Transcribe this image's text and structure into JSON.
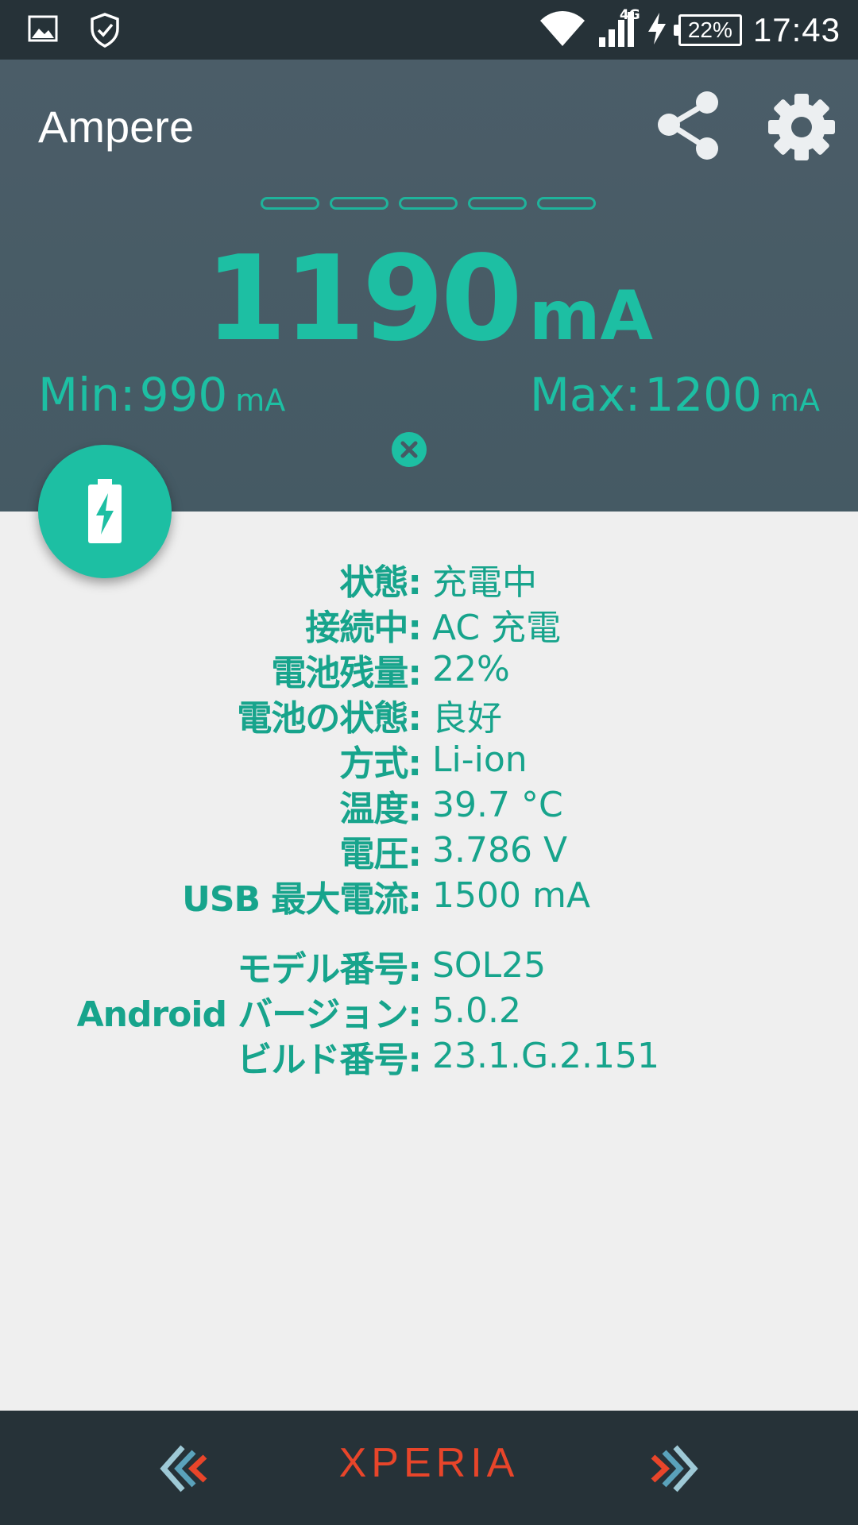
{
  "status_bar": {
    "time": "17:43",
    "battery_percent": "22%",
    "network_type": "4G",
    "icons": [
      "image-icon",
      "shield-check-icon",
      "wifi-icon",
      "cell-signal-icon",
      "charging-bolt-icon",
      "battery-icon"
    ]
  },
  "app": {
    "title": "Ampere",
    "actions": [
      "share-icon",
      "gear-icon"
    ]
  },
  "meter": {
    "current_value": "1190",
    "current_unit": "mA",
    "min_label": "Min:",
    "min_value": "990",
    "min_unit": "mA",
    "max_label": "Max:",
    "max_value": "1200",
    "max_unit": "mA",
    "accent_color": "#1dbfa3"
  },
  "info": {
    "battery_rows": [
      {
        "label": "状態:",
        "value": "充電中"
      },
      {
        "label": "接続中:",
        "value": "AC 充電"
      },
      {
        "label": "電池残量:",
        "value": "22%"
      },
      {
        "label": "電池の状態:",
        "value": "良好"
      },
      {
        "label": "方式:",
        "value": "Li-ion"
      },
      {
        "label": "温度:",
        "value": "39.7 °C"
      },
      {
        "label": "電圧:",
        "value": "3.786 V"
      },
      {
        "label": "USB 最大電流:",
        "value": "1500 mA"
      }
    ],
    "device_rows": [
      {
        "label": "モデル番号:",
        "value": "SOL25"
      },
      {
        "label": "Android バージョン:",
        "value": "5.0.2"
      },
      {
        "label": "ビルド番号:",
        "value": "23.1.G.2.151"
      }
    ]
  },
  "nav_bar": {
    "brand": "XPERIA",
    "brand_color": "#e8452a"
  }
}
